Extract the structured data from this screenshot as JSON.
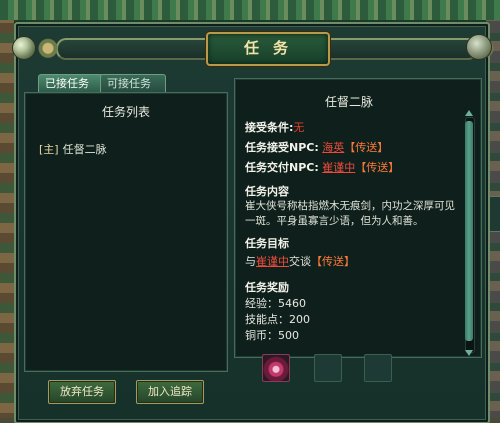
{
  "window": {
    "title": "任务"
  },
  "tabs": [
    {
      "label": "已接任务",
      "active": true
    },
    {
      "label": "可接任务",
      "active": false
    }
  ],
  "quest_list": {
    "header": "任务列表",
    "items": [
      {
        "tag": "[主]",
        "name": "任督二脉"
      }
    ]
  },
  "buttons": {
    "abandon": "放弃任务",
    "track": "加入追踪"
  },
  "quest_detail": {
    "title": "任督二脉",
    "accept_condition_label": "接受条件:",
    "accept_condition_value": "无",
    "accept_npc_label": "任务接受NPC:",
    "accept_npc_name": "海英",
    "accept_npc_teleport": "【传送】",
    "submit_npc_label": "任务交付NPC:",
    "submit_npc_name": "崔谨中",
    "submit_npc_teleport": "【传送】",
    "content_label": "任务内容",
    "content_text": "崔大侠号称枯指燃木无痕剑，内功之深厚可见一斑。平身虽寡言少语，但为人和善。",
    "objective_label": "任务目标",
    "objective_prefix": "与",
    "objective_npc": "崔谨中",
    "objective_suffix": "交谈",
    "objective_teleport": "【传送】",
    "reward_label": "任务奖励",
    "rewards": [
      {
        "label": "经验：",
        "value": "5460"
      },
      {
        "label": "技能点：",
        "value": "200"
      },
      {
        "label": "铜币：",
        "value": "500"
      }
    ]
  },
  "colors": {
    "link_red": "#ee4a3a",
    "link_orange": "#ff7a3a",
    "title_gold": "#f3e3a8",
    "panel_bg": "#0f201c"
  },
  "icons": {
    "reward_item": "pink-gem-icon",
    "close": "close-orb-icon"
  }
}
